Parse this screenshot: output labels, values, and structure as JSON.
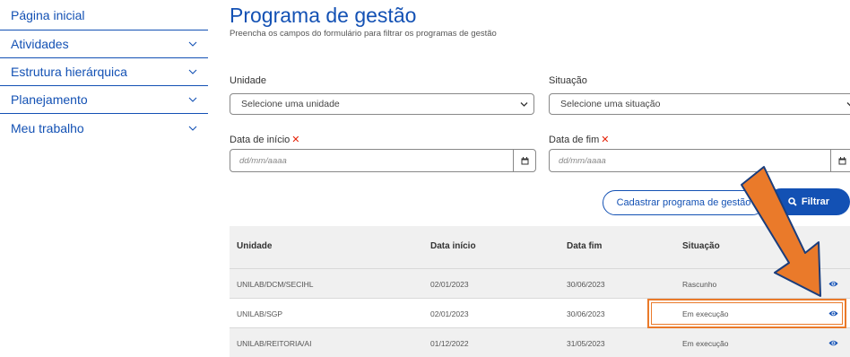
{
  "sidebar": {
    "items": [
      {
        "label": "Página inicial",
        "expandable": false
      },
      {
        "label": "Atividades",
        "expandable": true
      },
      {
        "label": "Estrutura hierárquica",
        "expandable": true
      },
      {
        "label": "Planejamento",
        "expandable": true
      },
      {
        "label": "Meu trabalho",
        "expandable": true
      }
    ]
  },
  "header": {
    "title": "Programa de gestão",
    "subtitle": "Preencha os campos do formulário para filtrar os programas de gestão"
  },
  "filters": {
    "unidade": {
      "label": "Unidade",
      "value": "Selecione uma unidade"
    },
    "situacao": {
      "label": "Situação",
      "value": "Selecione uma situação"
    },
    "data_inicio": {
      "label": "Data de início",
      "placeholder": "dd/mm/aaaa",
      "required": true
    },
    "data_fim": {
      "label": "Data de fim",
      "placeholder": "dd/mm/aaaa",
      "required": true
    }
  },
  "actions": {
    "cadastrar_label": "Cadastrar programa de gestão",
    "filtrar_label": "Filtrar"
  },
  "table": {
    "columns": [
      "Unidade",
      "Data início",
      "Data fim",
      "Situação"
    ],
    "rows": [
      {
        "unidade": "UNILAB/DCM/SECIHL",
        "inicio": "02/01/2023",
        "fim": "30/06/2023",
        "situacao": "Rascunho"
      },
      {
        "unidade": "UNILAB/SGP",
        "inicio": "02/01/2023",
        "fim": "30/06/2023",
        "situacao": "Em execução"
      },
      {
        "unidade": "UNILAB/REITORIA/AI",
        "inicio": "01/12/2022",
        "fim": "31/05/2023",
        "situacao": "Em execução"
      }
    ]
  },
  "colors": {
    "primary": "#1351b4",
    "required": "#e52207",
    "annotation": "#ea7a2a"
  }
}
